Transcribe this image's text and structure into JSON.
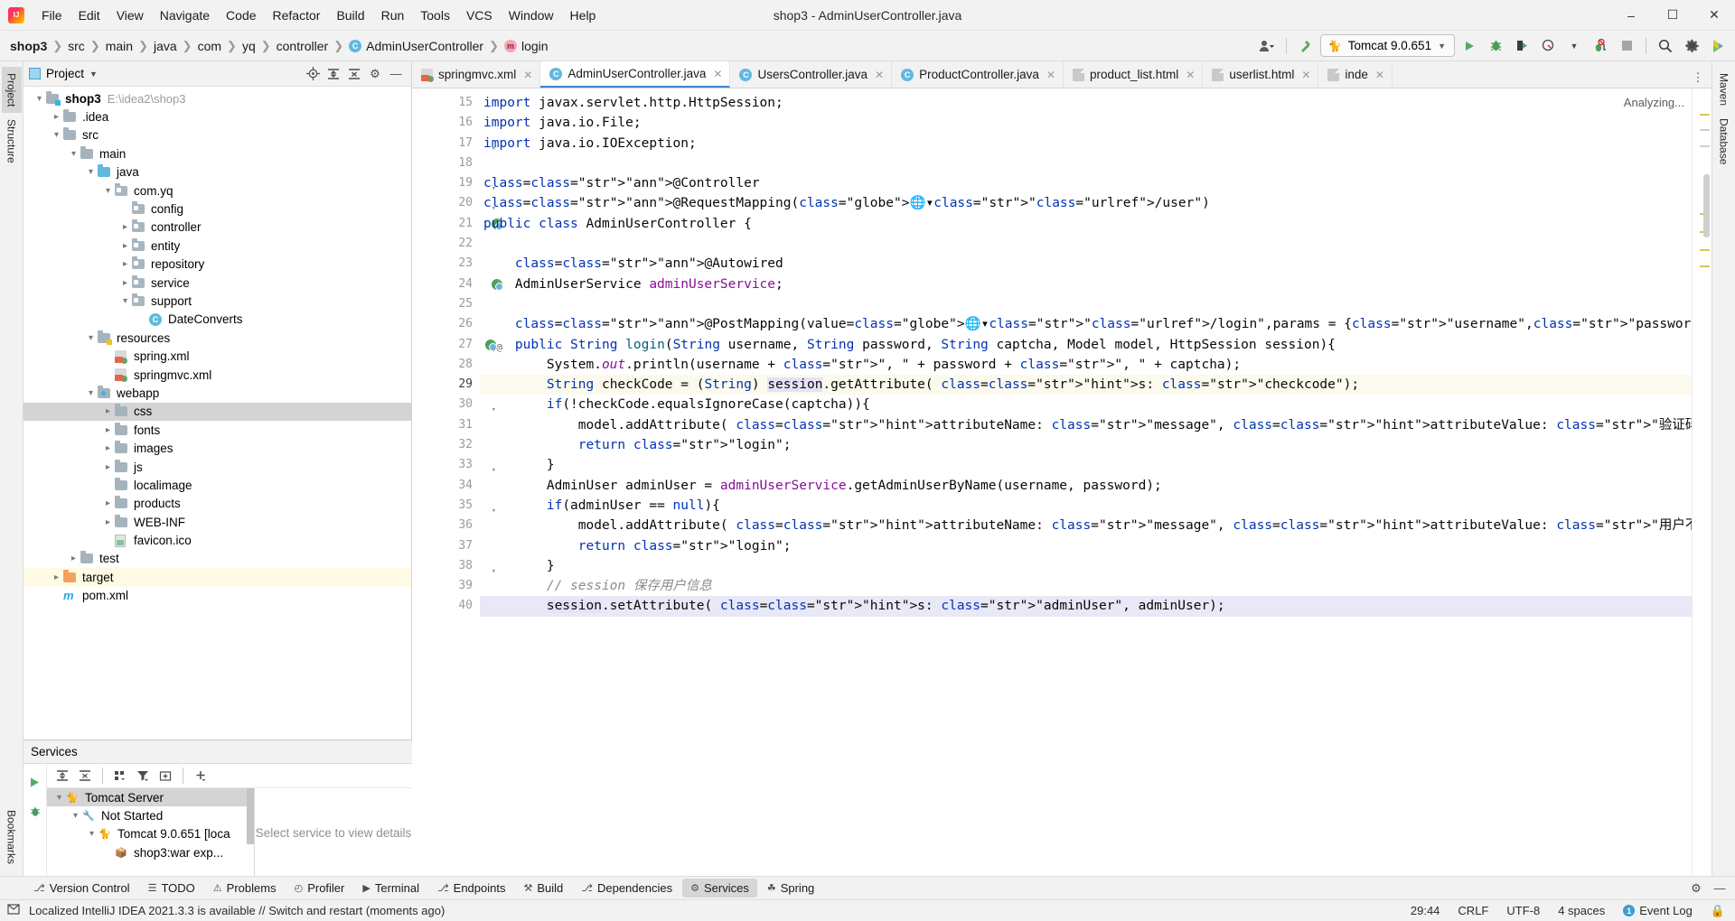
{
  "window": {
    "title": "shop3 - AdminUserController.java",
    "minimize": "–",
    "maximize": "☐",
    "close": "✕"
  },
  "menu": [
    "File",
    "Edit",
    "View",
    "Navigate",
    "Code",
    "Refactor",
    "Build",
    "Run",
    "Tools",
    "VCS",
    "Window",
    "Help"
  ],
  "breadcrumb": [
    {
      "label": "shop3",
      "bold": true,
      "badge": null
    },
    {
      "label": "src",
      "bold": false,
      "badge": null
    },
    {
      "label": "main",
      "bold": false,
      "badge": null
    },
    {
      "label": "java",
      "bold": false,
      "badge": null
    },
    {
      "label": "com",
      "bold": false,
      "badge": null
    },
    {
      "label": "yq",
      "bold": false,
      "badge": null
    },
    {
      "label": "controller",
      "bold": false,
      "badge": null
    },
    {
      "label": "AdminUserController",
      "bold": false,
      "badge": "C"
    },
    {
      "label": "login",
      "bold": false,
      "badge": "m"
    }
  ],
  "toolbar": {
    "run_config": "Tomcat 9.0.651",
    "tomcat_icon": "tomcat-icon",
    "icons": [
      "user-avatar-icon",
      "hammer-build-icon",
      "run-icon",
      "debug-icon",
      "run-coverage-icon",
      "profiler-icon",
      "stop-icon",
      "search-everywhere-icon",
      "settings-gear-icon",
      "updates-icon"
    ]
  },
  "project_panel": {
    "title": "Project",
    "header_icons": [
      "locate-icon",
      "expand-all-icon",
      "collapse-all-icon",
      "settings-icon",
      "hide-icon"
    ],
    "tree": [
      {
        "label": "shop3",
        "path": "E:\\idea2\\shop3",
        "indent": 0,
        "arrow": "v",
        "icon": "folder-module",
        "bold": true,
        "state": ""
      },
      {
        "label": ".idea",
        "path": "",
        "indent": 1,
        "arrow": ">",
        "icon": "folder",
        "bold": false,
        "state": ""
      },
      {
        "label": "src",
        "path": "",
        "indent": 1,
        "arrow": "v",
        "icon": "folder",
        "bold": false,
        "state": ""
      },
      {
        "label": "main",
        "path": "",
        "indent": 2,
        "arrow": "v",
        "icon": "folder",
        "bold": false,
        "state": ""
      },
      {
        "label": "java",
        "path": "",
        "indent": 3,
        "arrow": "v",
        "icon": "folder-source",
        "bold": false,
        "state": ""
      },
      {
        "label": "com.yq",
        "path": "",
        "indent": 4,
        "arrow": "v",
        "icon": "folder-package",
        "bold": false,
        "state": ""
      },
      {
        "label": "config",
        "path": "",
        "indent": 5,
        "arrow": "",
        "icon": "folder-package",
        "bold": false,
        "state": ""
      },
      {
        "label": "controller",
        "path": "",
        "indent": 5,
        "arrow": ">",
        "icon": "folder-package",
        "bold": false,
        "state": ""
      },
      {
        "label": "entity",
        "path": "",
        "indent": 5,
        "arrow": ">",
        "icon": "folder-package",
        "bold": false,
        "state": ""
      },
      {
        "label": "repository",
        "path": "",
        "indent": 5,
        "arrow": ">",
        "icon": "folder-package",
        "bold": false,
        "state": ""
      },
      {
        "label": "service",
        "path": "",
        "indent": 5,
        "arrow": ">",
        "icon": "folder-package",
        "bold": false,
        "state": ""
      },
      {
        "label": "support",
        "path": "",
        "indent": 5,
        "arrow": "v",
        "icon": "folder-package",
        "bold": false,
        "state": ""
      },
      {
        "label": "DateConverts",
        "path": "",
        "indent": 6,
        "arrow": "",
        "icon": "java-class",
        "bold": false,
        "state": ""
      },
      {
        "label": "resources",
        "path": "",
        "indent": 3,
        "arrow": "v",
        "icon": "folder-resources",
        "bold": false,
        "state": ""
      },
      {
        "label": "spring.xml",
        "path": "",
        "indent": 4,
        "arrow": "",
        "icon": "spring-xml",
        "bold": false,
        "state": ""
      },
      {
        "label": "springmvc.xml",
        "path": "",
        "indent": 4,
        "arrow": "",
        "icon": "spring-xml",
        "bold": false,
        "state": ""
      },
      {
        "label": "webapp",
        "path": "",
        "indent": 3,
        "arrow": "v",
        "icon": "folder-webapp",
        "bold": false,
        "state": ""
      },
      {
        "label": "css",
        "path": "",
        "indent": 4,
        "arrow": ">",
        "icon": "folder",
        "bold": false,
        "state": "sel"
      },
      {
        "label": "fonts",
        "path": "",
        "indent": 4,
        "arrow": ">",
        "icon": "folder",
        "bold": false,
        "state": ""
      },
      {
        "label": "images",
        "path": "",
        "indent": 4,
        "arrow": ">",
        "icon": "folder",
        "bold": false,
        "state": ""
      },
      {
        "label": "js",
        "path": "",
        "indent": 4,
        "arrow": ">",
        "icon": "folder",
        "bold": false,
        "state": ""
      },
      {
        "label": "localimage",
        "path": "",
        "indent": 4,
        "arrow": "",
        "icon": "folder",
        "bold": false,
        "state": ""
      },
      {
        "label": "products",
        "path": "",
        "indent": 4,
        "arrow": ">",
        "icon": "folder",
        "bold": false,
        "state": ""
      },
      {
        "label": "WEB-INF",
        "path": "",
        "indent": 4,
        "arrow": ">",
        "icon": "folder",
        "bold": false,
        "state": ""
      },
      {
        "label": "favicon.ico",
        "path": "",
        "indent": 4,
        "arrow": "",
        "icon": "image-file",
        "bold": false,
        "state": ""
      },
      {
        "label": "test",
        "path": "",
        "indent": 2,
        "arrow": ">",
        "icon": "folder",
        "bold": false,
        "state": ""
      },
      {
        "label": "target",
        "path": "",
        "indent": 1,
        "arrow": ">",
        "icon": "folder-target",
        "bold": false,
        "state": "hl"
      },
      {
        "label": "pom.xml",
        "path": "",
        "indent": 1,
        "arrow": "",
        "icon": "maven-file",
        "bold": false,
        "state": ""
      }
    ]
  },
  "editor": {
    "tabs": [
      {
        "label": "springmvc.xml",
        "icon": "spring-xml-icon",
        "active": false
      },
      {
        "label": "AdminUserController.java",
        "icon": "java-class-icon",
        "active": true
      },
      {
        "label": "UsersController.java",
        "icon": "java-class-icon",
        "active": false
      },
      {
        "label": "ProductController.java",
        "icon": "java-class-icon",
        "active": false
      },
      {
        "label": "product_list.html",
        "icon": "html-file-icon",
        "active": false
      },
      {
        "label": "userlist.html",
        "icon": "html-file-icon",
        "active": false
      },
      {
        "label": "inde",
        "icon": "html-file-icon",
        "active": false
      }
    ],
    "analyzing": "Analyzing...",
    "first_line": 15,
    "lines": [
      {
        "n": 15,
        "text": "import javax.servlet.http.HttpSession;"
      },
      {
        "n": 16,
        "text": "import java.io.File;"
      },
      {
        "n": 17,
        "text": "import java.io.IOException;"
      },
      {
        "n": 18,
        "text": ""
      },
      {
        "n": 19,
        "text": "@Controller"
      },
      {
        "n": 20,
        "text": "@RequestMapping(\"/user\")"
      },
      {
        "n": 21,
        "text": "public class AdminUserController {"
      },
      {
        "n": 22,
        "text": ""
      },
      {
        "n": 23,
        "text": "    @Autowired"
      },
      {
        "n": 24,
        "text": "    AdminUserService adminUserService;"
      },
      {
        "n": 25,
        "text": ""
      },
      {
        "n": 26,
        "text": "    @PostMapping(value=\"/login\",params = {\"username\",\"password\",\"captcha\"})"
      },
      {
        "n": 27,
        "text": "    public String login(String username, String password, String captcha, Model model, HttpSession session){"
      },
      {
        "n": 28,
        "text": "        System.out.println(username + \", \" + password + \", \" + captcha);"
      },
      {
        "n": 29,
        "text": "        String checkCode = (String) session.getAttribute( s: \"checkcode\");"
      },
      {
        "n": 30,
        "text": "        if(!checkCode.equalsIgnoreCase(captcha)){"
      },
      {
        "n": 31,
        "text": "            model.addAttribute( attributeName: \"message\", attributeValue: \"验证码有误\");"
      },
      {
        "n": 32,
        "text": "            return \"login\";"
      },
      {
        "n": 33,
        "text": "        }"
      },
      {
        "n": 34,
        "text": "        AdminUser adminUser = adminUserService.getAdminUserByName(username, password);"
      },
      {
        "n": 35,
        "text": "        if(adminUser == null){"
      },
      {
        "n": 36,
        "text": "            model.addAttribute( attributeName: \"message\", attributeValue: \"用户不存在\");"
      },
      {
        "n": 37,
        "text": "            return \"login\";"
      },
      {
        "n": 38,
        "text": "        }"
      },
      {
        "n": 39,
        "text": "        // session 保存用户信息"
      },
      {
        "n": 40,
        "text": "        session.setAttribute( s: \"adminUser\", adminUser);"
      }
    ]
  },
  "services": {
    "title": "Services",
    "toolbar_icons": [
      "run-icon",
      "expand-all-icon",
      "collapse-all-icon",
      "group-icon",
      "filter-icon",
      "add-tab-icon",
      "add-icon"
    ],
    "rail_icons": [
      "run-icon",
      "debug-icon"
    ],
    "tree": [
      {
        "label": "Tomcat Server",
        "indent": 0,
        "arrow": "v",
        "icon": "tomcat-icon",
        "sel": true
      },
      {
        "label": "Not Started",
        "indent": 1,
        "arrow": "v",
        "icon": "wrench-icon",
        "sel": false
      },
      {
        "label": "Tomcat 9.0.651 [loca",
        "indent": 2,
        "arrow": "v",
        "icon": "tomcat-icon",
        "sel": false
      },
      {
        "label": "shop3:war exp...",
        "indent": 3,
        "arrow": "",
        "icon": "war-icon",
        "sel": false
      }
    ],
    "detail_placeholder": "Select service to view details"
  },
  "left_rail": [
    "Project",
    "Structure"
  ],
  "left_rail_bottom": [
    "Bookmarks"
  ],
  "right_rail": [
    "Maven",
    "Database"
  ],
  "toolwindow_bar": [
    {
      "label": "Version Control",
      "icon": "branch-icon",
      "active": false
    },
    {
      "label": "TODO",
      "icon": "list-icon",
      "active": false
    },
    {
      "label": "Problems",
      "icon": "warning-icon",
      "active": false
    },
    {
      "label": "Profiler",
      "icon": "profiler-icon",
      "active": false
    },
    {
      "label": "Terminal",
      "icon": "terminal-icon",
      "active": false
    },
    {
      "label": "Endpoints",
      "icon": "endpoints-icon",
      "active": false
    },
    {
      "label": "Build",
      "icon": "build-icon",
      "active": false
    },
    {
      "label": "Dependencies",
      "icon": "dependencies-icon",
      "active": false
    },
    {
      "label": "Services",
      "icon": "services-icon",
      "active": true
    },
    {
      "label": "Spring",
      "icon": "spring-icon",
      "active": false
    }
  ],
  "statusbar": {
    "message": "Localized IntelliJ IDEA 2021.3.3 is available // Switch and restart (moments ago)",
    "caret": "29:44",
    "line_sep": "CRLF",
    "encoding": "UTF-8",
    "indent": "4 spaces",
    "event_log": "Event Log",
    "event_count": "1"
  }
}
